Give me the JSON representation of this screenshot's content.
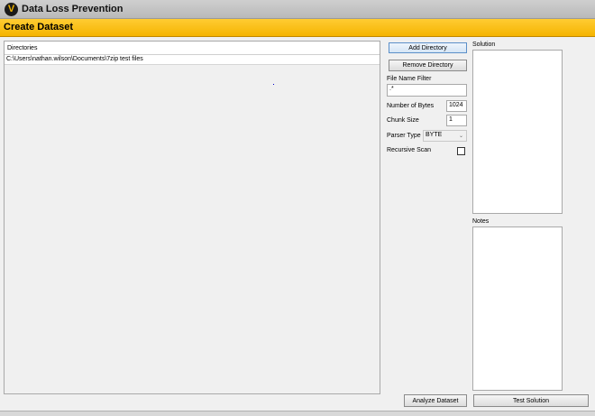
{
  "app": {
    "title": "Data Loss Prevention",
    "logo_letter": "V"
  },
  "page": {
    "title": "Create Dataset"
  },
  "directories": {
    "header": "Directories",
    "items": [
      "C:\\Users\\nathan.wilson\\Documents\\7zip test files"
    ]
  },
  "buttons": {
    "add_directory": "Add Directory",
    "remove_directory": "Remove Directory",
    "analyze_dataset": "Analyze Dataset",
    "test_solution": "Test Solution"
  },
  "filters": {
    "file_name_filter_label": "File Name Filter",
    "file_name_filter_value": ".*",
    "number_of_bytes_label": "Number of Bytes",
    "number_of_bytes_value": "1024",
    "chunk_size_label": "Chunk Size",
    "chunk_size_value": "1",
    "parser_type_label": "Parser Type",
    "parser_type_value": "BYTE",
    "recursive_scan_label": "Recursive Scan"
  },
  "solution": {
    "label": "Solution"
  },
  "notes": {
    "label": "Notes"
  },
  "colors": {
    "accent": "#f5b400",
    "titlebar": "#c4c4c4"
  }
}
